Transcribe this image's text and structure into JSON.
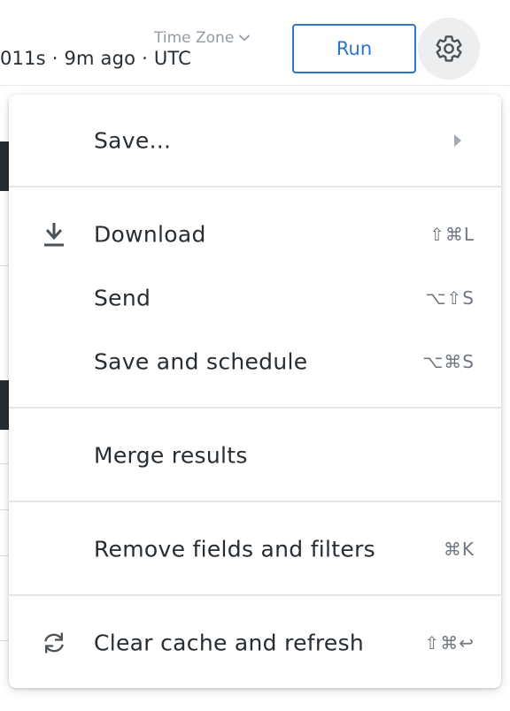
{
  "header": {
    "run_info": "011s · 9m ago · UTC",
    "timezone_label": "Time Zone",
    "run_label": "Run"
  },
  "icons": {
    "settings": "gear-icon",
    "timezone_dropdown": "chevron-down-icon",
    "download": "download-icon",
    "refresh": "refresh-icon",
    "submenu": "caret-right-icon"
  },
  "menu": {
    "save_label": "Save...",
    "download_label": "Download",
    "download_shortcut": "⇧⌘L",
    "send_label": "Send",
    "send_shortcut": "⌥⇧S",
    "schedule_label": "Save and schedule",
    "schedule_shortcut": "⌥⌘S",
    "merge_label": "Merge results",
    "remove_label": "Remove fields and filters",
    "remove_shortcut": "⌘K",
    "clear_label": "Clear cache and refresh",
    "clear_shortcut": "⇧⌘↩"
  },
  "colors": {
    "accent": "#2b74d1",
    "text": "#262d33",
    "muted": "#939ba5"
  }
}
